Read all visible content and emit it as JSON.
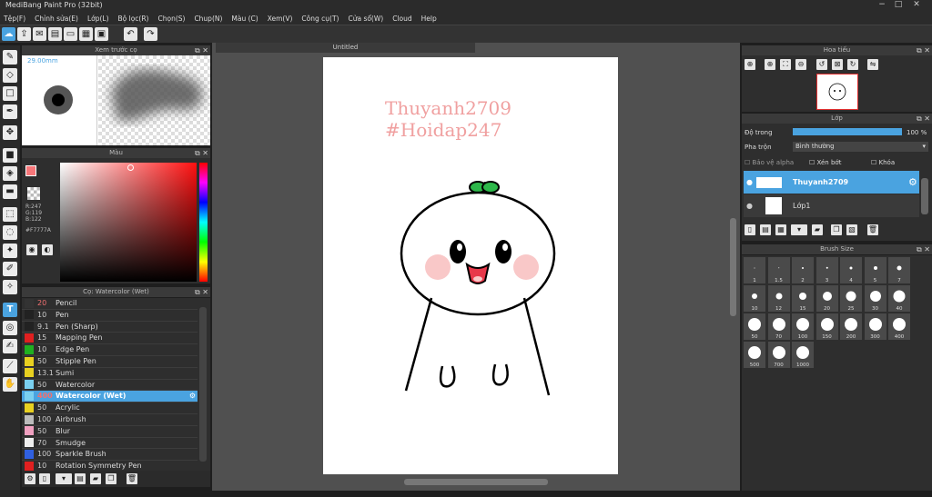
{
  "app": {
    "title": "MediBang Paint Pro (32bit)",
    "window_controls": [
      "−",
      "□",
      "✕"
    ]
  },
  "menu": [
    "Tệp(F)",
    "Chỉnh sửa(E)",
    "Lớp(L)",
    "Bộ lọc(R)",
    "Chọn(S)",
    "Chup(N)",
    "Màu (C)",
    "Xem(V)",
    "Công cụ(T)",
    "Cửa sổ(W)",
    "Cloud",
    "Help"
  ],
  "preview_panel": {
    "title": "Xem trước cọ",
    "size_label": "29.00mm"
  },
  "color_panel": {
    "title": "Màu",
    "primary_color": "#F7777A",
    "rgb_r": "R:247",
    "rgb_g": "G:119",
    "rgb_b": "B:122",
    "hex": "#F7777A"
  },
  "brush_panel": {
    "title": "Cọ: Watercolor (Wet)",
    "brushes": [
      {
        "size": "20",
        "name": "Pencil",
        "color": "#333333"
      },
      {
        "size": "10",
        "name": "Pen",
        "color": "#222222"
      },
      {
        "size": "9.1",
        "name": "Pen (Sharp)",
        "color": "#222222"
      },
      {
        "size": "15",
        "name": "Mapping Pen",
        "color": "#e02020"
      },
      {
        "size": "10",
        "name": "Edge Pen",
        "color": "#20b020"
      },
      {
        "size": "50",
        "name": "Stipple Pen",
        "color": "#e8d020"
      },
      {
        "size": "13.1",
        "name": "Sumi",
        "color": "#e8d020"
      },
      {
        "size": "50",
        "name": "Watercolor",
        "color": "#7ad0f0"
      },
      {
        "size": "400",
        "name": "Watercolor (Wet)",
        "color": "#7ad0f0"
      },
      {
        "size": "50",
        "name": "Acrylic",
        "color": "#e8d020"
      },
      {
        "size": "100",
        "name": "Airbrush",
        "color": "#bbbbbb"
      },
      {
        "size": "50",
        "name": "Blur",
        "color": "#f0a0c0"
      },
      {
        "size": "70",
        "name": "Smudge",
        "color": "#eeeeee"
      },
      {
        "size": "100",
        "name": "Sparkle Brush",
        "color": "#3060e0"
      },
      {
        "size": "10",
        "name": "Rotation Symmetry Pen",
        "color": "#e02020"
      }
    ],
    "selected_index": 8
  },
  "canvas": {
    "tab_title": "Untitled",
    "text_line1": "Thuyanh2709",
    "text_line2": "#Hoidap247",
    "blush_color": "#f9c8c8",
    "sprout_color": "#2db84a"
  },
  "navigator_panel": {
    "title": "Hoa tiếu"
  },
  "layer_panel": {
    "title": "Lớp",
    "opacity_label": "Độ trong",
    "opacity_value": "100 %",
    "opacity_fraction": 1.0,
    "blend_label": "Pha trộn",
    "blend_value": "Bình thường",
    "protect_alpha": "Bảo vệ alpha",
    "clipping": "Xén bớt",
    "lock": "Khóa",
    "layers": [
      {
        "name": "Thuyanh2709",
        "selected": true
      },
      {
        "name": "Lớp1",
        "selected": false
      }
    ]
  },
  "brush_size_panel": {
    "title": "Brush Size",
    "sizes": [
      "1",
      "1.5",
      "2",
      "3",
      "4",
      "5",
      "7",
      "10",
      "12",
      "15",
      "20",
      "25",
      "30",
      "40",
      "50",
      "70",
      "100",
      "150",
      "200",
      "300",
      "400",
      "500",
      "700",
      "1000"
    ]
  },
  "accent_color": "#4aa3e0"
}
